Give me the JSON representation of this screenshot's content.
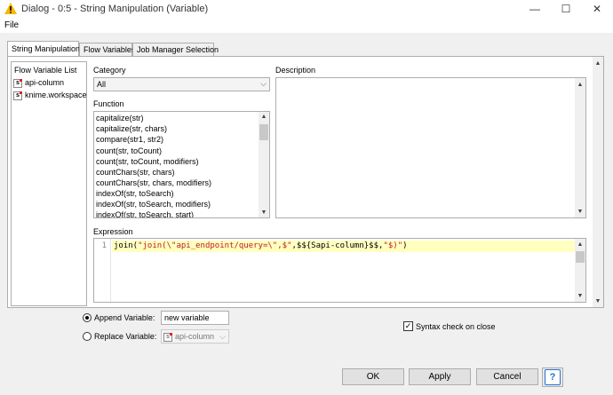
{
  "window": {
    "title": "Dialog - 0:5 - String Manipulation (Variable)",
    "minimize": "—",
    "maximize": "☐",
    "close": "✕"
  },
  "menu": {
    "file": "File"
  },
  "tabs": [
    {
      "label": "String Manipulation"
    },
    {
      "label": "Flow Variables"
    },
    {
      "label": "Job Manager Selection"
    }
  ],
  "flow_variable_list": {
    "title": "Flow Variable List",
    "items": [
      {
        "label": "api-column"
      },
      {
        "label": "knime.workspace"
      }
    ]
  },
  "category": {
    "label": "Category",
    "value": "All"
  },
  "description": {
    "label": "Description"
  },
  "function": {
    "label": "Function",
    "items": [
      "capitalize(str)",
      "capitalize(str, chars)",
      "compare(str1, str2)",
      "count(str, toCount)",
      "count(str, toCount, modifiers)",
      "countChars(str, chars)",
      "countChars(str, chars, modifiers)",
      "indexOf(str, toSearch)",
      "indexOf(str, toSearch, modifiers)",
      "indexOf(str, toSearch, start)"
    ]
  },
  "expression": {
    "label": "Expression",
    "line_number": "1",
    "parts": {
      "p1": "join(",
      "p2": "\"join(\\\"api_endpoint/query=\\\",$\"",
      "p3": ",",
      "p4": "$${Sapi-column}$$",
      "p5": ",",
      "p6": "\"$)\"",
      "p7": ")"
    }
  },
  "append_variable": {
    "label": "Append Variable:",
    "value": "new variable",
    "selected": true
  },
  "replace_variable": {
    "label": "Replace Variable:",
    "value": "api-column",
    "selected": false
  },
  "syntax_check": {
    "label": "Syntax check on close",
    "checked": true,
    "mark": "✓"
  },
  "buttons": {
    "ok": "OK",
    "apply": "Apply",
    "cancel": "Cancel",
    "help": "?"
  },
  "colors": {
    "accent": "#2a6fd0",
    "highlight_line": "#ffffc0",
    "string": "#c21a1a",
    "warning": "#f5b800"
  },
  "icons": {
    "title": "warning-icon",
    "variable": "string-variable-icon"
  }
}
